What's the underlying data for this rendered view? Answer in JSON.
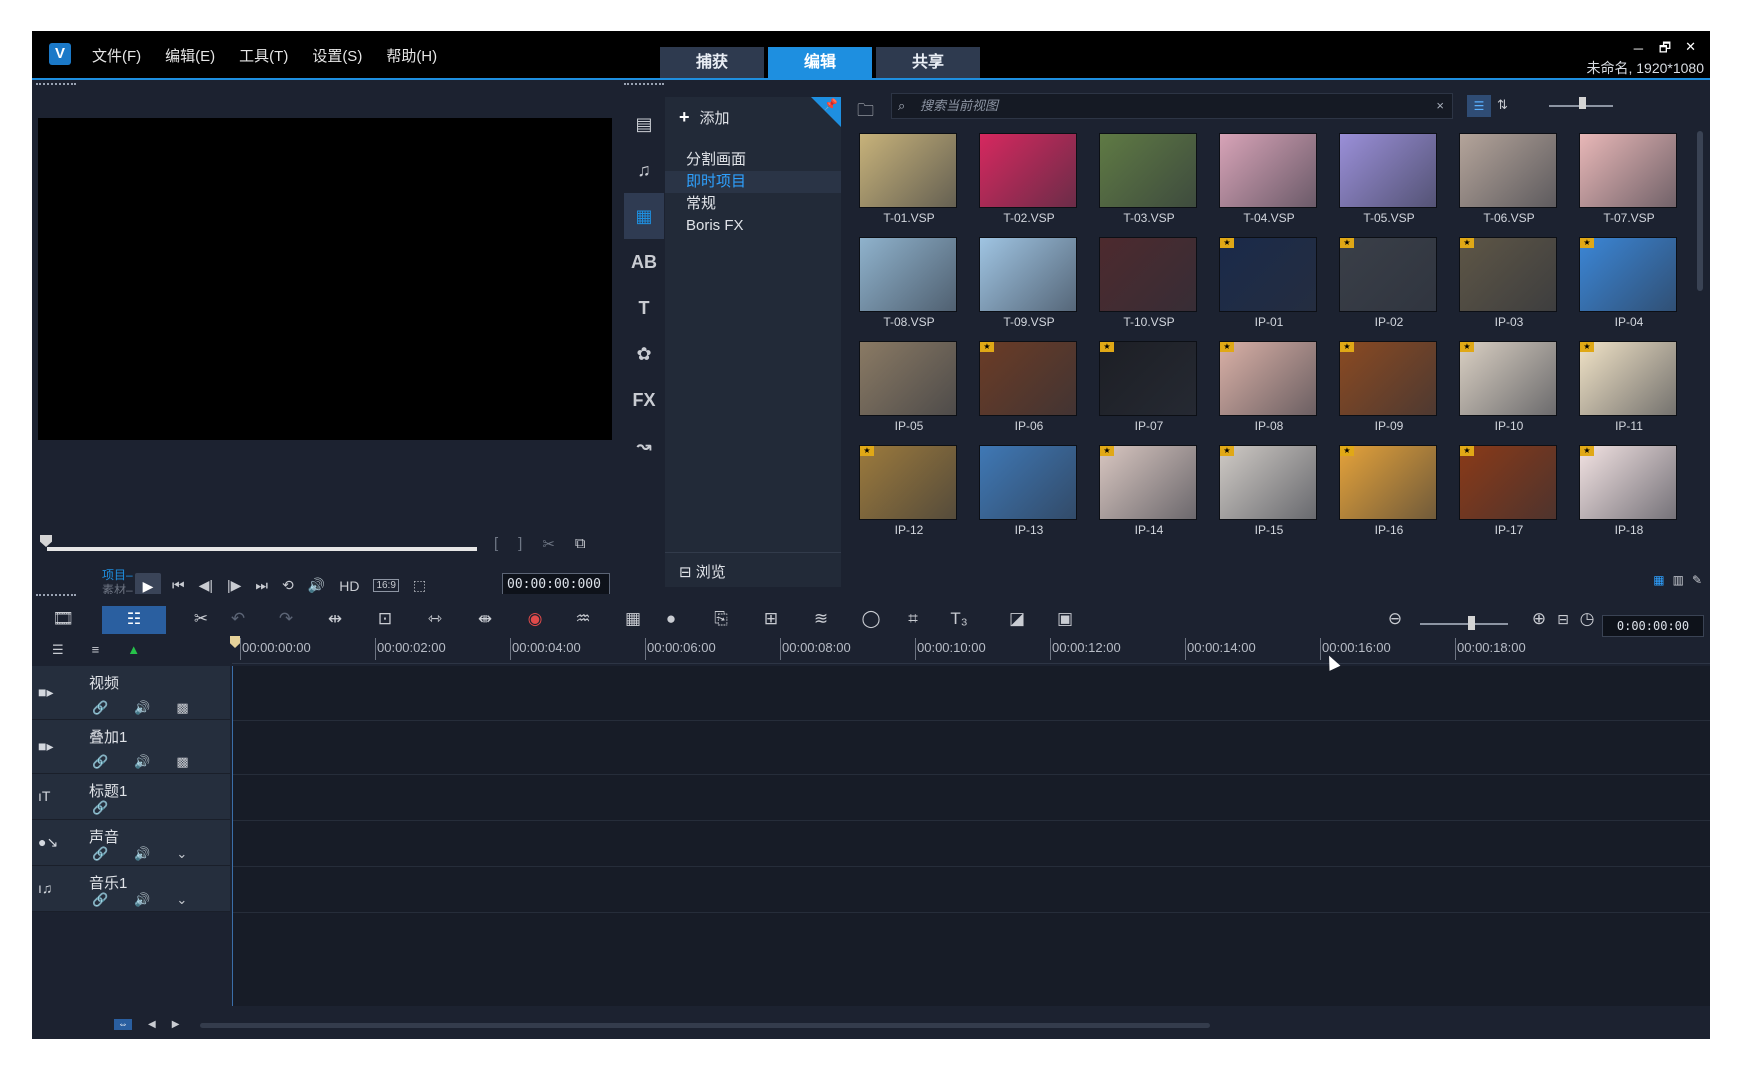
{
  "app": {
    "logo": "V",
    "menu": [
      "文件(F)",
      "编辑(E)",
      "工具(T)",
      "设置(S)",
      "帮助(H)"
    ],
    "tabs": [
      {
        "label": "捕获",
        "active": false
      },
      {
        "label": "编辑",
        "active": true
      },
      {
        "label": "共享",
        "active": false
      }
    ],
    "window_controls": [
      "－",
      "🗗",
      "✕"
    ],
    "project_name": "未命名, 1920*1080",
    "accent_color": "#1e8fe0"
  },
  "preview": {
    "project_label": "项目–",
    "clip_label": "素材–",
    "play_icon": "▶",
    "transport_icons": [
      "⏮",
      "◀|",
      "|▶",
      "⏭",
      "⟲",
      "🔊"
    ],
    "hd_label": "HD",
    "ratio_label": "16:9",
    "timecode": "00:00:00:000"
  },
  "library": {
    "add_label": "添加",
    "categories": [
      {
        "label": "分割画面",
        "selected": false
      },
      {
        "label": "即时项目",
        "selected": true
      },
      {
        "label": "常规",
        "selected": false
      },
      {
        "label": "Boris FX",
        "selected": false
      }
    ],
    "browse_label": "浏览",
    "search_placeholder": "搜索当前视图",
    "side_icons": [
      "media-icon",
      "audio-icon",
      "instant-project-icon",
      "transition-icon",
      "title-icon",
      "graphic-icon",
      "fx-icon",
      "path-icon"
    ],
    "side_icon_text": [
      "▤",
      "♫",
      "▦",
      "AB",
      "T",
      "✿",
      "FX",
      "↝"
    ],
    "items": [
      {
        "label": "T-01.VSP",
        "color": "#c7b27a",
        "star": false
      },
      {
        "label": "T-02.VSP",
        "color": "#d6285f",
        "star": false
      },
      {
        "label": "T-03.VSP",
        "color": "#5f7a44",
        "star": false
      },
      {
        "label": "T-04.VSP",
        "color": "#d7a3b7",
        "star": false
      },
      {
        "label": "T-05.VSP",
        "color": "#9a8fd8",
        "star": false
      },
      {
        "label": "T-06.VSP",
        "color": "#b4a49a",
        "star": false
      },
      {
        "label": "T-07.VSP",
        "color": "#e8b7b7",
        "star": false
      },
      {
        "label": "T-08.VSP",
        "color": "#8fb2cc",
        "star": false
      },
      {
        "label": "T-09.VSP",
        "color": "#9fc4e2",
        "star": false
      },
      {
        "label": "T-10.VSP",
        "color": "#4d2a2e",
        "star": false
      },
      {
        "label": "IP-01",
        "color": "#1a2a4a",
        "star": true
      },
      {
        "label": "IP-02",
        "color": "#3a3f48",
        "star": true
      },
      {
        "label": "IP-03",
        "color": "#5e5646",
        "star": true
      },
      {
        "label": "IP-04",
        "color": "#3b86d6",
        "star": true
      },
      {
        "label": "IP-05",
        "color": "#8a7a64",
        "star": false
      },
      {
        "label": "IP-06",
        "color": "#6b3c26",
        "star": true
      },
      {
        "label": "IP-07",
        "color": "#1d1f25",
        "star": true
      },
      {
        "label": "IP-08",
        "color": "#d9b0a6",
        "star": true
      },
      {
        "label": "IP-09",
        "color": "#8a4a22",
        "star": true
      },
      {
        "label": "IP-10",
        "color": "#d9cfc2",
        "star": true
      },
      {
        "label": "IP-11",
        "color": "#f0e2c6",
        "star": true
      },
      {
        "label": "IP-12",
        "color": "#9c7a3c",
        "star": true
      },
      {
        "label": "IP-13",
        "color": "#3f78b5",
        "star": false
      },
      {
        "label": "IP-14",
        "color": "#d8c6c0",
        "star": true
      },
      {
        "label": "IP-15",
        "color": "#cfcac5",
        "star": true
      },
      {
        "label": "IP-16",
        "color": "#e4a23a",
        "star": true
      },
      {
        "label": "IP-17",
        "color": "#8a3a18",
        "star": true
      },
      {
        "label": "IP-18",
        "color": "#f2e2e2",
        "star": true
      }
    ]
  },
  "timeline": {
    "timecode": "0:00:00:00",
    "ruler": [
      "00:00:00:00",
      "00:00:02:00",
      "00:00:04:00",
      "00:00:06:00",
      "00:00:08:00",
      "00:00:10:00",
      "00:00:12:00",
      "00:00:14:00",
      "00:00:16:00",
      "00:00:18:00"
    ],
    "tracks": [
      {
        "name": "视频",
        "type_icon": "■▸",
        "controls": [
          "🔗",
          "🔊",
          "▩"
        ]
      },
      {
        "name": "叠加1",
        "type_icon": "■▸",
        "controls": [
          "🔗",
          "🔊",
          "▩"
        ]
      },
      {
        "name": "标题1",
        "type_icon": "ıT",
        "controls": [
          "🔗"
        ]
      },
      {
        "name": "声音",
        "type_icon": "●↘",
        "controls": [
          "🔗",
          "🔊",
          "⌄"
        ]
      },
      {
        "name": "音乐1",
        "type_icon": "ı♫",
        "controls": [
          "🔗",
          "🔊",
          "⌄"
        ]
      }
    ]
  }
}
